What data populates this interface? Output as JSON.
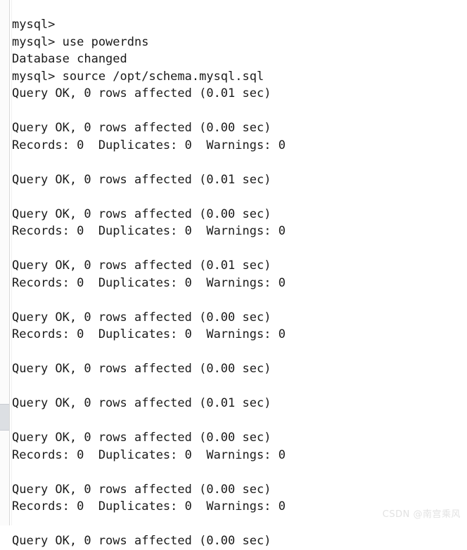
{
  "terminal": {
    "prompt": "mysql>",
    "database": "powerdns",
    "script_path": "/opt/schema.mysql.sql",
    "lines": [
      "mysql>",
      "mysql> use powerdns",
      "Database changed",
      "mysql> source /opt/schema.mysql.sql",
      "Query OK, 0 rows affected (0.01 sec)",
      "",
      "Query OK, 0 rows affected (0.00 sec)",
      "Records: 0  Duplicates: 0  Warnings: 0",
      "",
      "Query OK, 0 rows affected (0.01 sec)",
      "",
      "Query OK, 0 rows affected (0.00 sec)",
      "Records: 0  Duplicates: 0  Warnings: 0",
      "",
      "Query OK, 0 rows affected (0.01 sec)",
      "Records: 0  Duplicates: 0  Warnings: 0",
      "",
      "Query OK, 0 rows affected (0.00 sec)",
      "Records: 0  Duplicates: 0  Warnings: 0",
      "",
      "Query OK, 0 rows affected (0.00 sec)",
      "",
      "Query OK, 0 rows affected (0.01 sec)",
      "",
      "Query OK, 0 rows affected (0.00 sec)",
      "Records: 0  Duplicates: 0  Warnings: 0",
      "",
      "Query OK, 0 rows affected (0.00 sec)",
      "Records: 0  Duplicates: 0  Warnings: 0",
      "",
      "Query OK, 0 rows affected (0.00 sec)"
    ]
  },
  "scrollbar": {
    "orientation": "vertical",
    "position": "left"
  },
  "watermark": {
    "text": "CSDN @南宫乘风"
  },
  "colors": {
    "background": "#ffffff",
    "text": "#1a1a1a",
    "scrollbar_thumb": "#dcdfe3",
    "watermark": "#e2e2e2"
  }
}
